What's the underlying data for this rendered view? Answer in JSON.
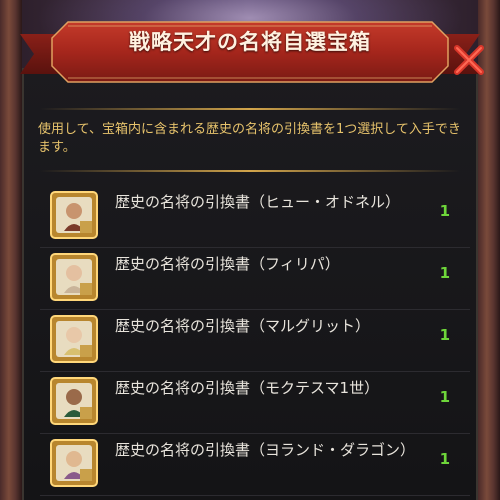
{
  "dialog": {
    "title": "戦略天才の名将自選宝箱",
    "description": "使用して、宝箱内に含まれる歴史の名将の引換書を1つ選択して入手できます。"
  },
  "items": [
    {
      "label": "歴史の名将の引換書（ヒュー・オドネル）",
      "count": "1"
    },
    {
      "label": "歴史の名将の引換書（フィリパ）",
      "count": "1"
    },
    {
      "label": "歴史の名将の引換書（マルグリット）",
      "count": "1"
    },
    {
      "label": "歴史の名将の引換書（モクテスマ1世）",
      "count": "1"
    },
    {
      "label": "歴史の名将の引換書（ヨランド・ダラゴン）",
      "count": "1"
    }
  ],
  "colors": {
    "banner_red": "#a5261c",
    "description_gold": "#e7c36c",
    "count_green": "#6ed63a",
    "close_red": "#d9362a"
  },
  "icons": {
    "item_icon": "scroll-portrait-icon",
    "close": "close-icon"
  }
}
